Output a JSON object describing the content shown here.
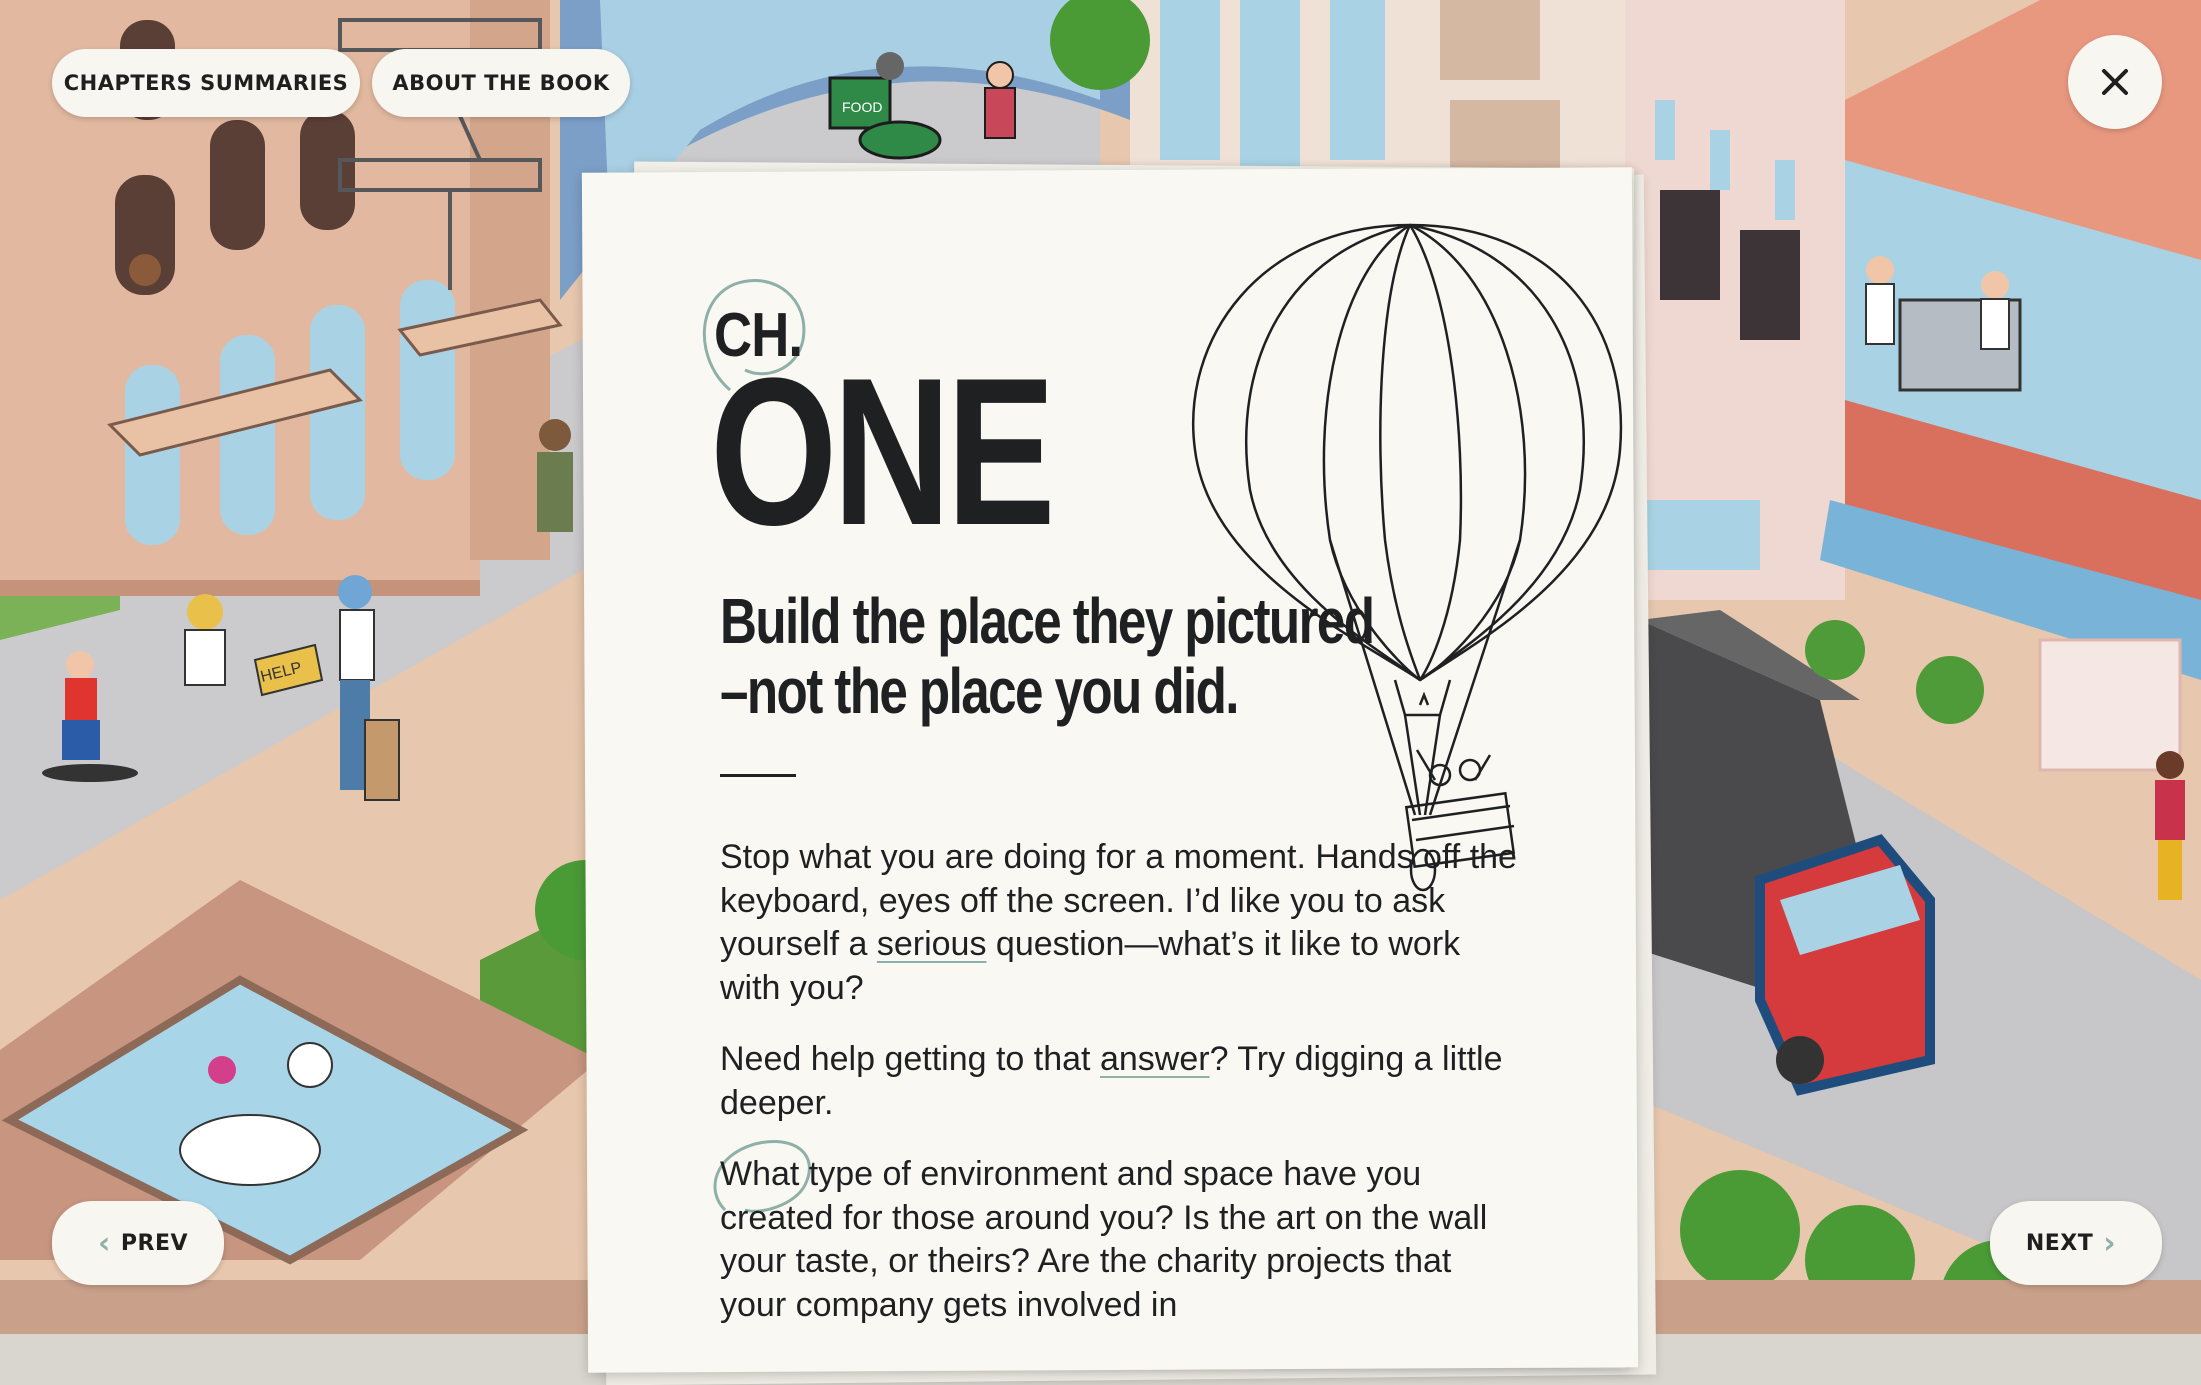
{
  "nav": {
    "chapters_label": "CHAPTERS SUMMARIES",
    "about_label": "ABOUT THE BOOK",
    "close_icon": "close-icon"
  },
  "chapter": {
    "ch_label": "CH.",
    "number_word": "ONE",
    "title_line1": "Build the place they pictured",
    "title_line2": "–not the place you did."
  },
  "body": {
    "p1_a": "Stop what you are doing for a moment. Hands off the keyboard, eyes off the screen. I’d like you to ask yourself a ",
    "p1_emph": "serious",
    "p1_b": " question—what’s it like to work with you?",
    "p2_a": "Need help getting to that ",
    "p2_emph": "answer",
    "p2_b": "? Try digging a little deeper.",
    "p3": "What type of environment and space have you created for those around you? Is the art on the wall your taste, or theirs? Are the charity projects that your company gets involved in"
  },
  "illustration": {
    "help_sign": "HELP",
    "scooter_box": "FOOD"
  },
  "pagination": {
    "prev_label": "PREV",
    "next_label": "NEXT"
  },
  "colors": {
    "paper": "#f9f8f3",
    "ink": "#1f2022",
    "accent": "#8fb0a8",
    "road": "#c9c9cb",
    "building_tan": "#e2b9a0",
    "building_salmon": "#e99880",
    "window_blue": "#a9d3e4"
  }
}
